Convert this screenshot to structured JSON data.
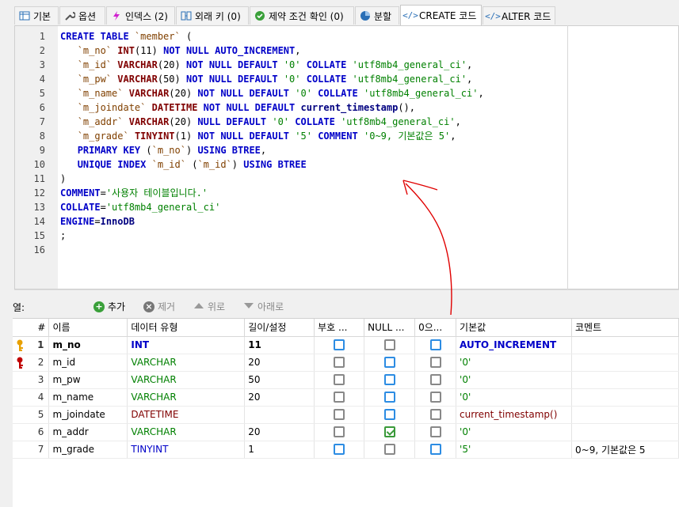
{
  "tabs": [
    {
      "label": "기본",
      "icon": "table-icon"
    },
    {
      "label": "옵션",
      "icon": "wrench-icon"
    },
    {
      "label": "인덱스 (2)",
      "icon": "lightning-icon"
    },
    {
      "label": "외래 키 (0)",
      "icon": "foreign-key-icon"
    },
    {
      "label": "제약 조건 확인 (0)",
      "icon": "check-icon"
    },
    {
      "label": "분할",
      "icon": "pie-icon"
    },
    {
      "label": "CREATE 코드",
      "icon": "code-icon",
      "active": true
    },
    {
      "label": "ALTER 코드",
      "icon": "code-icon"
    }
  ],
  "editor": {
    "line_numbers": [
      "1",
      "2",
      "3",
      "4",
      "5",
      "6",
      "7",
      "8",
      "9",
      "10",
      "11",
      "12",
      "13",
      "14",
      "15",
      "16"
    ]
  },
  "code_lines": [
    [
      [
        "kw",
        "CREATE TABLE "
      ],
      [
        "id",
        "`member`"
      ],
      [
        "pl",
        " ("
      ]
    ],
    [
      [
        "pl",
        "   "
      ],
      [
        "id",
        "`m_no`"
      ],
      [
        "pl",
        " "
      ],
      [
        "ty",
        "INT"
      ],
      [
        "pl",
        "(11) "
      ],
      [
        "kw",
        "NOT NULL AUTO_INCREMENT"
      ],
      [
        "pl",
        ","
      ]
    ],
    [
      [
        "pl",
        "   "
      ],
      [
        "id",
        "`m_id`"
      ],
      [
        "pl",
        " "
      ],
      [
        "ty",
        "VARCHAR"
      ],
      [
        "pl",
        "(20) "
      ],
      [
        "kw",
        "NOT NULL DEFAULT "
      ],
      [
        "str",
        "'0'"
      ],
      [
        "pl",
        " "
      ],
      [
        "kw",
        "COLLATE"
      ],
      [
        "pl",
        " "
      ],
      [
        "str",
        "'utf8mb4_general_ci'"
      ],
      [
        "pl",
        ","
      ]
    ],
    [
      [
        "pl",
        "   "
      ],
      [
        "id",
        "`m_pw`"
      ],
      [
        "pl",
        " "
      ],
      [
        "ty",
        "VARCHAR"
      ],
      [
        "pl",
        "(50) "
      ],
      [
        "kw",
        "NOT NULL DEFAULT "
      ],
      [
        "str",
        "'0'"
      ],
      [
        "pl",
        " "
      ],
      [
        "kw",
        "COLLATE"
      ],
      [
        "pl",
        " "
      ],
      [
        "str",
        "'utf8mb4_general_ci'"
      ],
      [
        "pl",
        ","
      ]
    ],
    [
      [
        "pl",
        "   "
      ],
      [
        "id",
        "`m_name`"
      ],
      [
        "pl",
        " "
      ],
      [
        "ty",
        "VARCHAR"
      ],
      [
        "pl",
        "(20) "
      ],
      [
        "kw",
        "NOT NULL DEFAULT "
      ],
      [
        "str",
        "'0'"
      ],
      [
        "pl",
        " "
      ],
      [
        "kw",
        "COLLATE"
      ],
      [
        "pl",
        " "
      ],
      [
        "str",
        "'utf8mb4_general_ci'"
      ],
      [
        "pl",
        ","
      ]
    ],
    [
      [
        "pl",
        "   "
      ],
      [
        "id",
        "`m_joindate`"
      ],
      [
        "pl",
        " "
      ],
      [
        "ty",
        "DATETIME"
      ],
      [
        "pl",
        " "
      ],
      [
        "kw",
        "NOT NULL DEFAULT "
      ],
      [
        "fn",
        "current_timestamp"
      ],
      [
        "pl",
        "(),"
      ]
    ],
    [
      [
        "pl",
        "   "
      ],
      [
        "id",
        "`m_addr`"
      ],
      [
        "pl",
        " "
      ],
      [
        "ty",
        "VARCHAR"
      ],
      [
        "pl",
        "(20) "
      ],
      [
        "kw",
        "NULL DEFAULT "
      ],
      [
        "str",
        "'0'"
      ],
      [
        "pl",
        " "
      ],
      [
        "kw",
        "COLLATE"
      ],
      [
        "pl",
        " "
      ],
      [
        "str",
        "'utf8mb4_general_ci'"
      ],
      [
        "pl",
        ","
      ]
    ],
    [
      [
        "pl",
        "   "
      ],
      [
        "id",
        "`m_grade`"
      ],
      [
        "pl",
        " "
      ],
      [
        "ty",
        "TINYINT"
      ],
      [
        "pl",
        "(1) "
      ],
      [
        "kw",
        "NOT NULL DEFAULT "
      ],
      [
        "str",
        "'5'"
      ],
      [
        "pl",
        " "
      ],
      [
        "kw",
        "COMMENT"
      ],
      [
        "pl",
        " "
      ],
      [
        "str",
        "'0~9, 기본값은 5'"
      ],
      [
        "pl",
        ","
      ]
    ],
    [
      [
        "pl",
        "   "
      ],
      [
        "kw",
        "PRIMARY KEY"
      ],
      [
        "pl",
        " ("
      ],
      [
        "id",
        "`m_no`"
      ],
      [
        "pl",
        ") "
      ],
      [
        "kw",
        "USING BTREE"
      ],
      [
        "pl",
        ","
      ]
    ],
    [
      [
        "pl",
        "   "
      ],
      [
        "kw",
        "UNIQUE INDEX"
      ],
      [
        "pl",
        " "
      ],
      [
        "id",
        "`m_id`"
      ],
      [
        "pl",
        " ("
      ],
      [
        "id",
        "`m_id`"
      ],
      [
        "pl",
        ") "
      ],
      [
        "kw",
        "USING BTREE"
      ]
    ],
    [
      [
        "pl",
        ")"
      ]
    ],
    [
      [
        "kw",
        "COMMENT"
      ],
      [
        "pl",
        "="
      ],
      [
        "str",
        "'사용자 테이블입니다.'"
      ]
    ],
    [
      [
        "kw",
        "COLLATE"
      ],
      [
        "pl",
        "="
      ],
      [
        "str",
        "'utf8mb4_general_ci'"
      ]
    ],
    [
      [
        "kw",
        "ENGINE"
      ],
      [
        "pl",
        "="
      ],
      [
        "fn",
        "InnoDB"
      ]
    ],
    [
      [
        "pl",
        ";"
      ]
    ],
    [
      [
        "pl",
        ""
      ]
    ]
  ],
  "columns_toolbar": {
    "label": "열:",
    "add": "추가",
    "remove": "제거",
    "up": "위로",
    "down": "아래로"
  },
  "grid": {
    "headers": [
      "#",
      "이름",
      "데이터 유형",
      "길이/설정",
      "부호 ...",
      "NULL ...",
      "0으...",
      "기본값",
      "코멘트"
    ],
    "rows": [
      {
        "num": "1",
        "name": "m_no",
        "type": "INT",
        "type_color": "blue",
        "length": "11",
        "unsigned": false,
        "nullable": false,
        "zerofill": false,
        "default": "AUTO_INCREMENT",
        "default_color": "blue",
        "comment": "",
        "key": "primary",
        "highlight": true
      },
      {
        "num": "2",
        "name": "m_id",
        "type": "VARCHAR",
        "type_color": "green",
        "length": "20",
        "unsigned": false,
        "nullable": false,
        "zerofill": false,
        "default": "'0'",
        "default_color": "green",
        "comment": "",
        "key": "unique"
      },
      {
        "num": "3",
        "name": "m_pw",
        "type": "VARCHAR",
        "type_color": "green",
        "length": "50",
        "unsigned": false,
        "nullable": false,
        "zerofill": false,
        "default": "'0'",
        "default_color": "green",
        "comment": ""
      },
      {
        "num": "4",
        "name": "m_name",
        "type": "VARCHAR",
        "type_color": "green",
        "length": "20",
        "unsigned": false,
        "nullable": false,
        "zerofill": false,
        "default": "'0'",
        "default_color": "green",
        "comment": ""
      },
      {
        "num": "5",
        "name": "m_joindate",
        "type": "DATETIME",
        "type_color": "red",
        "length": "",
        "unsigned": false,
        "nullable": false,
        "zerofill": false,
        "default": "current_timestamp()",
        "default_color": "red",
        "comment": ""
      },
      {
        "num": "6",
        "name": "m_addr",
        "type": "VARCHAR",
        "type_color": "green",
        "length": "20",
        "unsigned": false,
        "nullable": true,
        "zerofill": false,
        "default": "'0'",
        "default_color": "green",
        "comment": ""
      },
      {
        "num": "7",
        "name": "m_grade",
        "type": "TINYINT",
        "type_color": "blue",
        "length": "1",
        "unsigned": false,
        "nullable": false,
        "zerofill": false,
        "default": "'5'",
        "default_color": "green",
        "comment": "0~9, 기본값은 5"
      }
    ]
  },
  "colors": {
    "keyword": "#0000c8",
    "type": "#800000",
    "string": "#008000",
    "identifier": "#804000",
    "annotation_arrow": "#e00000",
    "primary_key": "#e8a000",
    "unique_key": "#c00000"
  }
}
